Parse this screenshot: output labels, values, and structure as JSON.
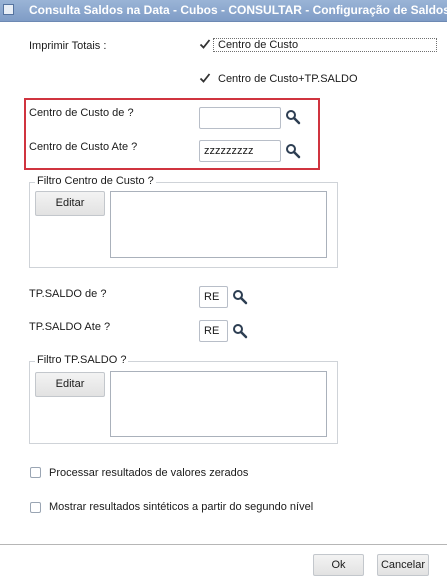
{
  "window": {
    "title": "Consulta Saldos na Data - Cubos - CONSULTAR - Configuração de Saldos"
  },
  "print_totals": {
    "label": "Imprimir Totais :",
    "options": [
      {
        "label": "Centro de Custo",
        "checked": true
      },
      {
        "label": "Centro de Custo+TP.SALDO",
        "checked": true
      }
    ]
  },
  "cost_center": {
    "from_label": "Centro de Custo de  ?",
    "from_value": "",
    "to_label": "Centro de Custo Ate  ?",
    "to_value": "zzzzzzzzz"
  },
  "filter_cost_center": {
    "label": "Filtro Centro de Custo ?",
    "edit_label": "Editar"
  },
  "tp_saldo": {
    "from_label": "TP.SALDO de  ?",
    "from_value": "RE",
    "to_label": "TP.SALDO Ate  ?",
    "to_value": "RE"
  },
  "filter_tp_saldo": {
    "label": "Filtro TP.SALDO ?",
    "edit_label": "Editar"
  },
  "options": {
    "zero_values": {
      "label": "Processar resultados de valores zerados",
      "checked": false
    },
    "synthetic": {
      "label": "Mostrar resultados sintéticos a partir do segundo nível",
      "checked": false
    }
  },
  "footer": {
    "ok_label": "Ok",
    "cancel_label": "Cancelar"
  },
  "colors": {
    "highlight": "#d0343f",
    "titlebar": "#8ba7cf"
  }
}
